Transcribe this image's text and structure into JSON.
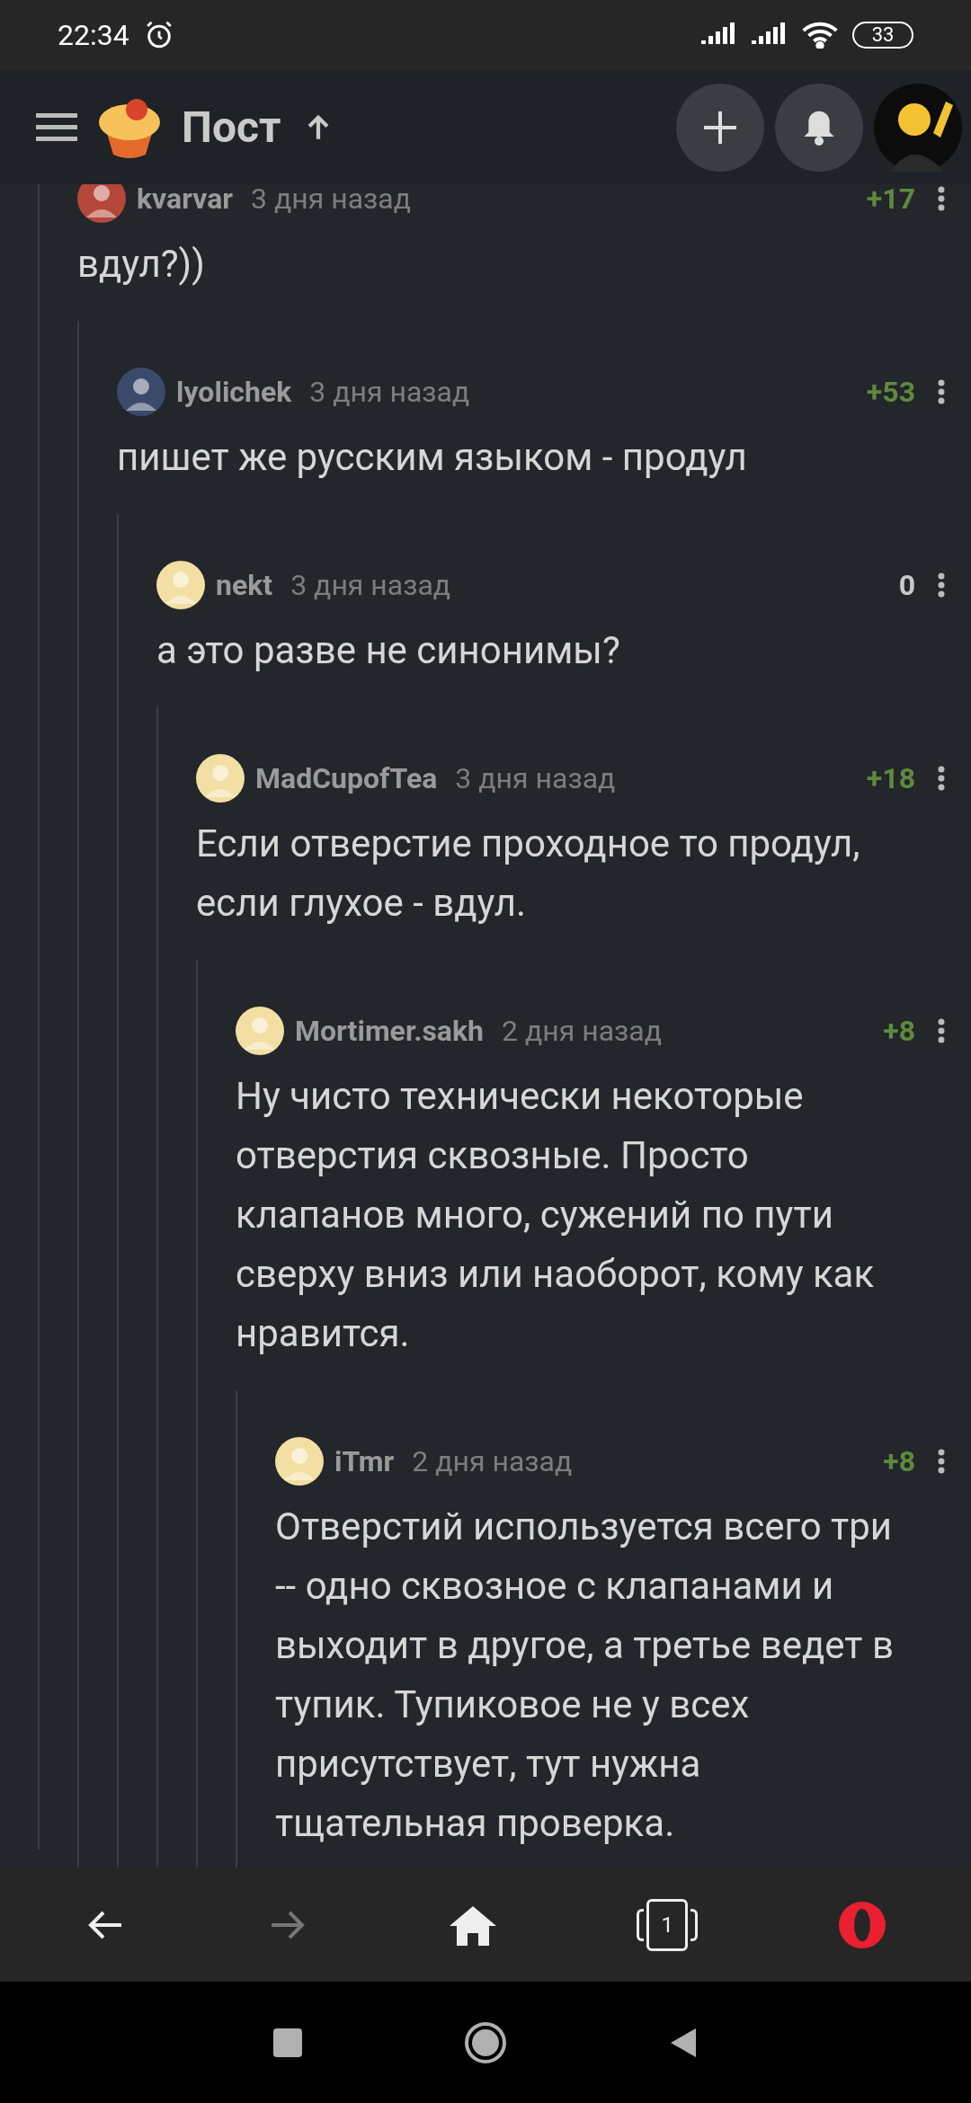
{
  "status_bar": {
    "time": "22:34",
    "battery": "33"
  },
  "header": {
    "title": "Пост"
  },
  "comments": [
    {
      "author": "kvarvar",
      "time": "3 дня назад",
      "score": "+17",
      "kind": "positive",
      "text": "вдул?))",
      "children": [
        {
          "author": "lyolichek",
          "time": "3 дня назад",
          "score": "+53",
          "kind": "positive",
          "text": "пишет же русским языком - продул",
          "children": [
            {
              "author": "nekt",
              "time": "3 дня назад",
              "score": "0",
              "kind": "neutral",
              "text": "а это разве не синонимы?",
              "children": [
                {
                  "author": "MadCupofTea",
                  "time": "3 дня назад",
                  "score": "+18",
                  "kind": "positive",
                  "text": "Если отверстие проходное то продул, если глухое - вдул.",
                  "children": [
                    {
                      "author": "Mortimer.sakh",
                      "time": "2 дня назад",
                      "score": "+8",
                      "kind": "positive",
                      "text": "Ну чисто технически некоторые отверстия сквозные. Просто клапанов много, сужений по пути сверху вниз или наоборот, кому как нравится.",
                      "children": [
                        {
                          "author": "iTmr",
                          "time": "2 дня назад",
                          "score": "+8",
                          "kind": "positive",
                          "text": "Отверстий используется всего три -- одно сквозное с клапанами и выходит в другое, а третье ведет в тупик. Тупиковое не у всех присутствует, тут нужна тщательная проверка."
                        }
                      ]
                    }
                  ]
                }
              ]
            }
          ]
        }
      ]
    }
  ],
  "bottom_nav": {
    "tab_count": "1",
    "forward_disabled": true
  }
}
